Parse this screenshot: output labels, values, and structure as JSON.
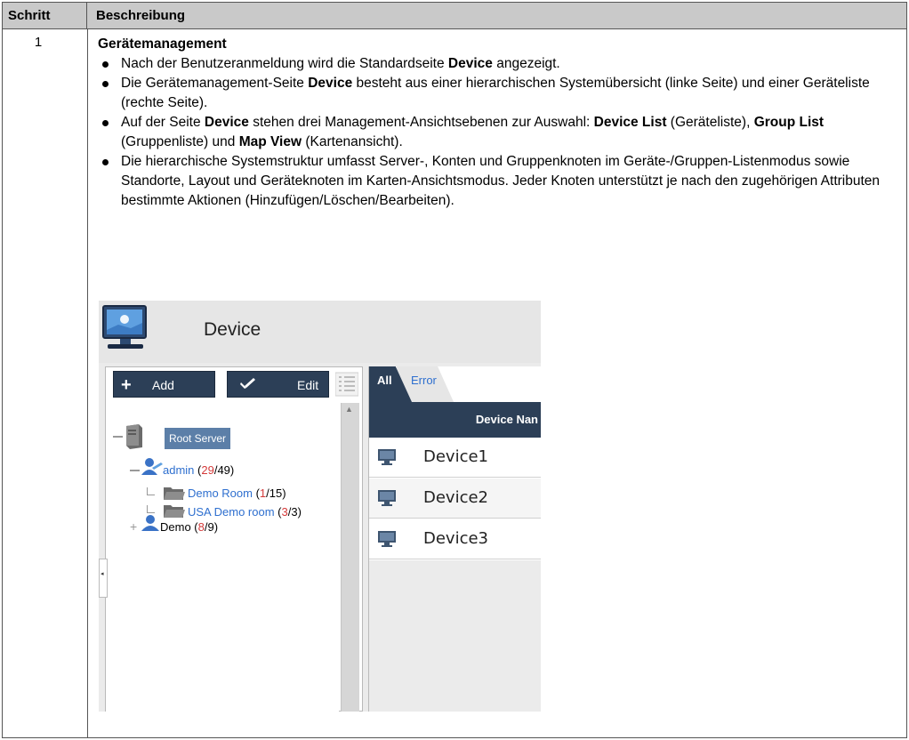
{
  "table": {
    "col1_header": "Schritt",
    "col2_header": "Beschreibung",
    "step_number": "1",
    "section_title": "Gerätemanagement"
  },
  "bullets": [
    {
      "pre": "Nach der Benutzeranmeldung wird die Standardseite ",
      "b1": "Device",
      "post": " angezeigt."
    },
    {
      "pre": "Die Gerätemanagement-Seite ",
      "b1": "Device",
      "post": " besteht aus einer hierarchischen Systemübersicht (linke Seite) und einer Geräteliste (rechte Seite)."
    },
    {
      "pre": "Auf der Seite ",
      "b1": "Device",
      "mid1": " stehen drei Management-Ansichtsebenen zur Auswahl: ",
      "b2": "Device List",
      "mid2": " (Geräteliste), ",
      "b3": "Group List",
      "mid3": " (Gruppenliste) und ",
      "b4": "Map View",
      "post": " (Kartenansicht)."
    },
    {
      "text": "Die hierarchische Systemstruktur umfasst Server-, Konten und Gruppenknoten im Geräte-/Gruppen-Listenmodus sowie Standorte, Layout und Geräteknoten im Karten-Ansichtsmodus. Jeder Knoten unterstützt je nach den zugehörigen Attributen bestimmte Aktionen (Hinzufügen/Löschen/Bearbeiten)."
    }
  ],
  "screenshot": {
    "title": "Device",
    "add_label": "Add",
    "edit_label": "Edit",
    "tree": {
      "root": "Root Server",
      "admin_name": "admin",
      "admin_count_a": "29",
      "admin_count_b": "/49",
      "demo_room": "Demo Room",
      "demo_room_a": "1",
      "demo_room_b": "/15",
      "usa_room": "USA Demo room",
      "usa_room_a": "3",
      "usa_room_b": "/3",
      "demo_name": "Demo",
      "demo_a": "8",
      "demo_b": "/9"
    },
    "tabs": {
      "all": "All",
      "error": "Error"
    },
    "column_header": "Device Nan",
    "devices": [
      "Device1",
      "Device2",
      "Device3"
    ],
    "colors": {
      "toolbar": "#2c3f57",
      "link_blue": "#2e6fcf",
      "count_red": "#d43a3a",
      "root_node": "#5c7fa8"
    },
    "icons": [
      "monitor-icon",
      "plus-icon",
      "pencil-icon",
      "list-view-icon",
      "server-icon",
      "user-icon",
      "folder-icon"
    ]
  }
}
